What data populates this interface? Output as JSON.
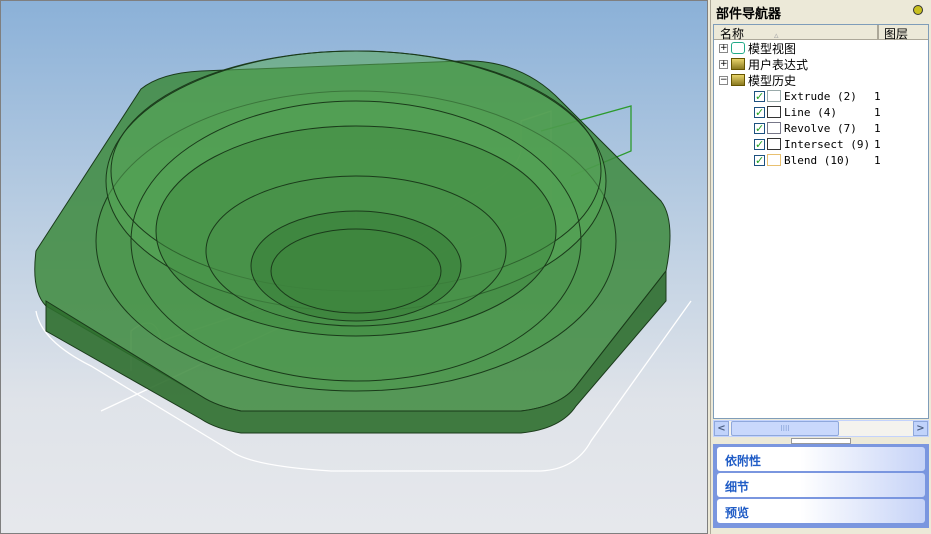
{
  "navigator": {
    "title": "部件导航器",
    "col_name": "名称",
    "col_layer": "图层",
    "nodes": [
      {
        "label": "模型视图",
        "expand": "+"
      },
      {
        "label": "用户表达式",
        "expand": "+"
      },
      {
        "label": "模型历史",
        "expand": "−"
      }
    ],
    "features": [
      {
        "label": "Extrude (2)",
        "layer": "1",
        "icon": "extrude-icon"
      },
      {
        "label": "Line (4)",
        "layer": "1",
        "icon": "line-icon"
      },
      {
        "label": "Revolve (7)",
        "layer": "1",
        "icon": "revolve-icon"
      },
      {
        "label": "Intersect (9)",
        "layer": "1",
        "icon": "intersect-icon"
      },
      {
        "label": "Blend (10)",
        "layer": "1",
        "icon": "blend-icon"
      }
    ],
    "check": "✓",
    "scroll_left": "<",
    "scroll_right": ">",
    "scroll_grip": "IIII"
  },
  "panels": [
    {
      "label": "依附性"
    },
    {
      "label": "细节"
    },
    {
      "label": "预览"
    }
  ]
}
